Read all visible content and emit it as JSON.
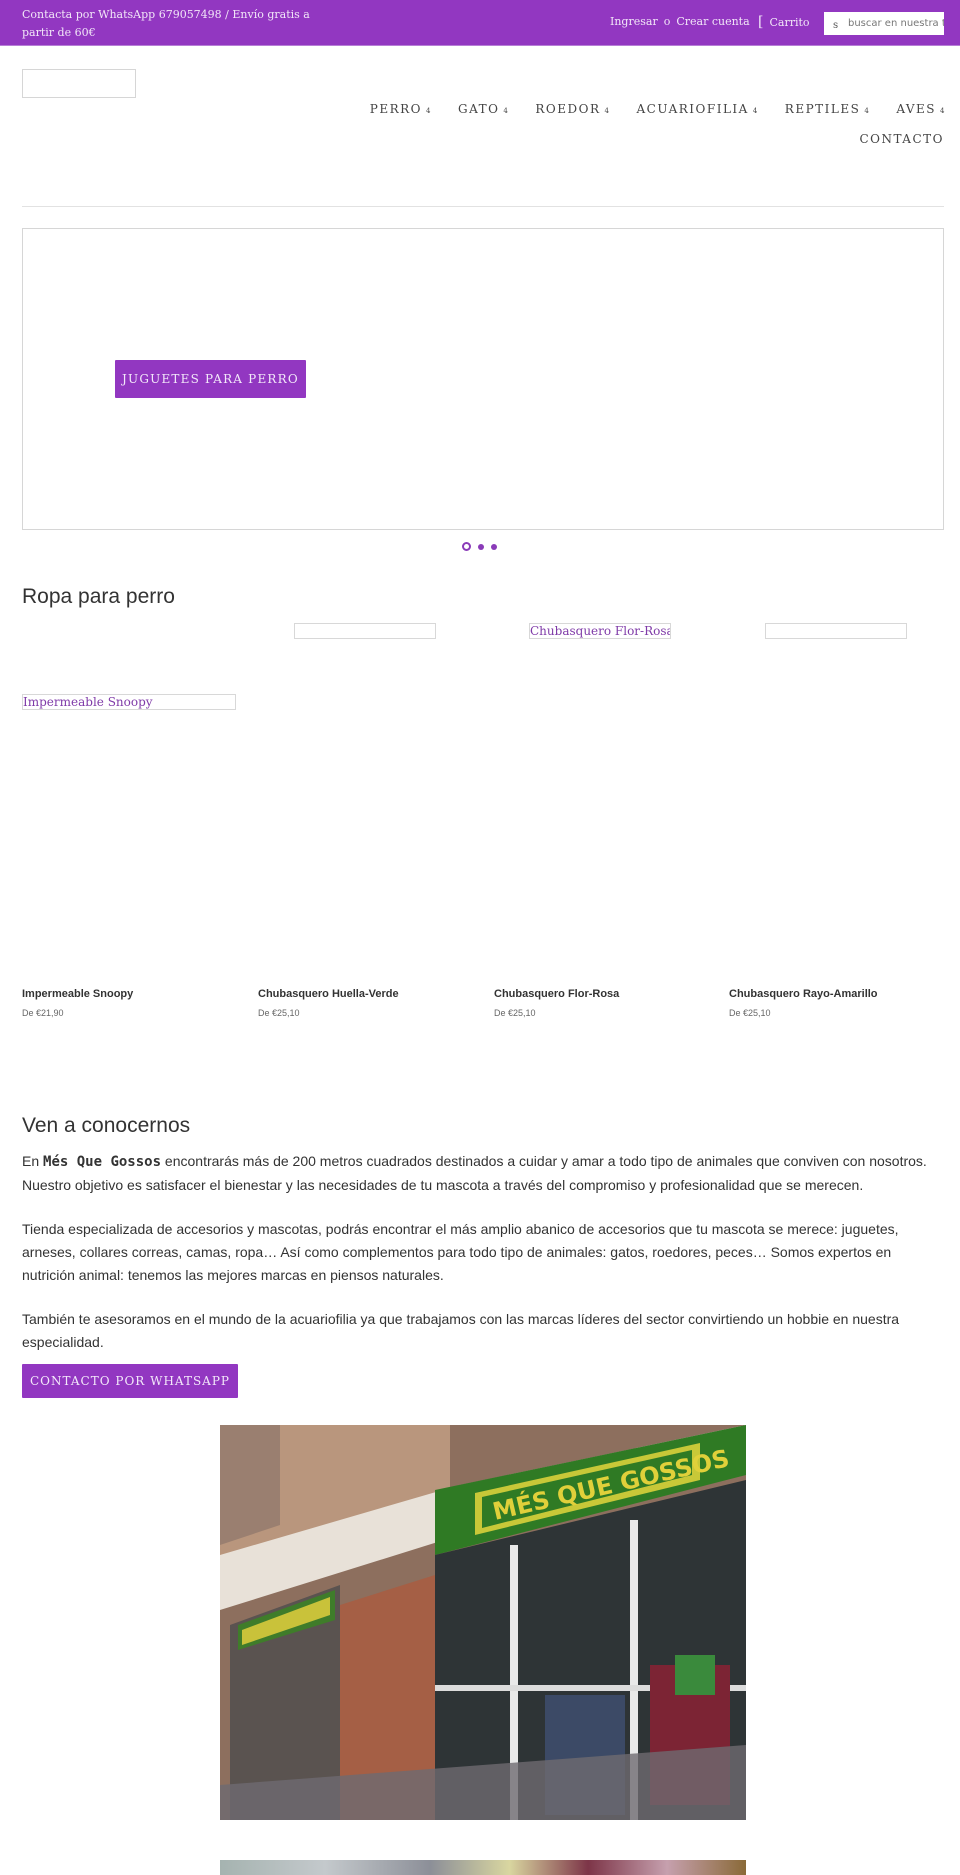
{
  "topbar": {
    "promo_text": "Contacta por WhatsApp 679057498 / Envío gratis a partir de 60€",
    "login_label": "Ingresar",
    "or_label": "o",
    "register_label": "Crear cuenta",
    "cart_icon": "[",
    "cart_label": "Carrito",
    "search_icon": "s",
    "search_placeholder": "buscar en nuestra tienda"
  },
  "header": {
    "nav": [
      {
        "label": "PERRO",
        "has_dropdown": true
      },
      {
        "label": "GATO",
        "has_dropdown": true
      },
      {
        "label": "ROEDOR",
        "has_dropdown": true
      },
      {
        "label": "ACUARIOFILIA",
        "has_dropdown": true
      },
      {
        "label": "REPTILES",
        "has_dropdown": true
      },
      {
        "label": "AVES",
        "has_dropdown": true
      }
    ],
    "nav_caret": "4",
    "contact_label": "CONTACTO"
  },
  "slider": {
    "button_label": "JUGUETES PARA PERRO",
    "slide_count": 3,
    "active_slide": 1
  },
  "products_section": {
    "title": "Ropa para perro",
    "image_alts": [
      "",
      "Chubasquero Flor-Rosa",
      "",
      "Impermeable Snoopy"
    ],
    "products": [
      {
        "name": "Impermeable Snoopy",
        "price": "De €21,90"
      },
      {
        "name": "Chubasquero Huella-Verde",
        "price": "De €25,10"
      },
      {
        "name": "Chubasquero Flor-Rosa",
        "price": "De €25,10"
      },
      {
        "name": "Chubasquero Rayo-Amarillo",
        "price": "De €25,10"
      }
    ]
  },
  "about": {
    "title": "Ven a conocernos",
    "p1_prefix": "En ",
    "brand": "Més Que Gossos",
    "p1_rest": " encontrarás más de 200 metros cuadrados destinados a cuidar y amar a todo tipo de animales que conviven con nosotros. Nuestro objetivo es satisfacer el bienestar y las necesidades de tu mascota a través del compromiso y profesionalidad que se merecen.",
    "p2": "Tienda especializada de accesorios y mascotas, podrás encontrar el más amplio abanico de accesorios que tu mascota se merece: juguetes, arneses, collares correas, camas, ropa… Así como complementos para todo tipo de animales: gatos, roedores, peces… Somos expertos en nutrición animal: tenemos las mejores marcas en piensos naturales.",
    "p3": "También te asesoramos en el mundo de la acuariofilia ya que trabajamos con las marcas líderes del sector convirtiendo un hobbie en nuestra especialidad.",
    "whatsapp_button": "CONTACTO POR WHATSAPP",
    "storefront_sign": "MÉS QUE GOSSOS"
  },
  "colors": {
    "brand": "#9237c1",
    "link": "#7f3aa8"
  }
}
